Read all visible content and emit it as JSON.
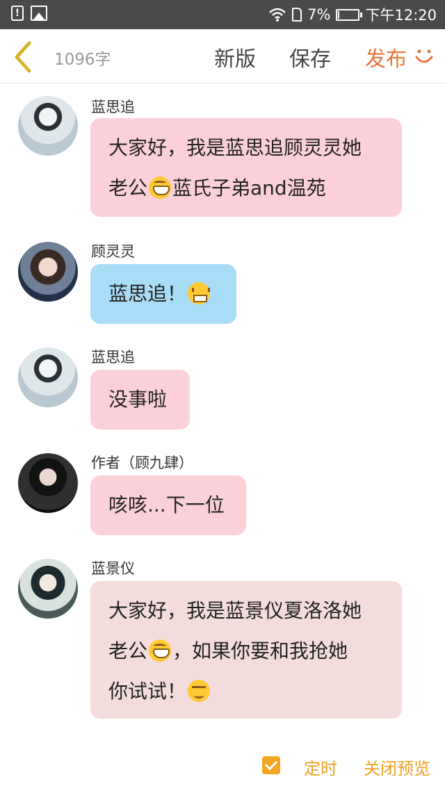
{
  "status_bar": {
    "battery": "7%",
    "time": "下午12:20",
    "icons": [
      "alert-icon",
      "image-icon",
      "wifi-icon",
      "sim-icon",
      "battery-icon"
    ]
  },
  "toolbar": {
    "word_count": "1096字",
    "new_version": "新版",
    "save": "保存",
    "publish": "发布",
    "accent_color": "#e3773a"
  },
  "messages": [
    {
      "author": "蓝思追",
      "avatar": "avatar-lan-sizhui",
      "bubble_color": "#fcd0d9",
      "lines": [
        {
          "text": "大家好，我是蓝思追顾灵灵她"
        },
        {
          "before": "老公",
          "emoji": "grin-emoji",
          "after": "蓝氏子弟and温苑"
        }
      ]
    },
    {
      "author": "顾灵灵",
      "avatar": "avatar-gu-lingling",
      "bubble_color": "#a9dcf6",
      "lines": [
        {
          "before": "蓝思追！",
          "emoji": "angry-emoji",
          "after": ""
        }
      ]
    },
    {
      "author": "蓝思追",
      "avatar": "avatar-lan-sizhui",
      "bubble_color": "#fcd0d9",
      "lines": [
        {
          "text": "没事啦"
        }
      ]
    },
    {
      "author": "作者（顾九肆）",
      "avatar": "avatar-author",
      "bubble_color": "#fcd0d9",
      "lines": [
        {
          "text": "咳咳...下一位"
        }
      ]
    },
    {
      "author": "蓝景仪",
      "avatar": "avatar-lan-jingyi",
      "bubble_color": "#f4dcdc",
      "lines": [
        {
          "text": "大家好，我是蓝景仪夏洛洛她"
        },
        {
          "before": "老公",
          "emoji": "grin-emoji",
          "after": "，如果你要和我抢她"
        },
        {
          "before": "你试试！",
          "emoji": "smug-emoji",
          "after": ""
        }
      ]
    }
  ],
  "bottom_bar": {
    "timer_checked": true,
    "timer_label": "定时",
    "close_preview": "关闭预览"
  }
}
